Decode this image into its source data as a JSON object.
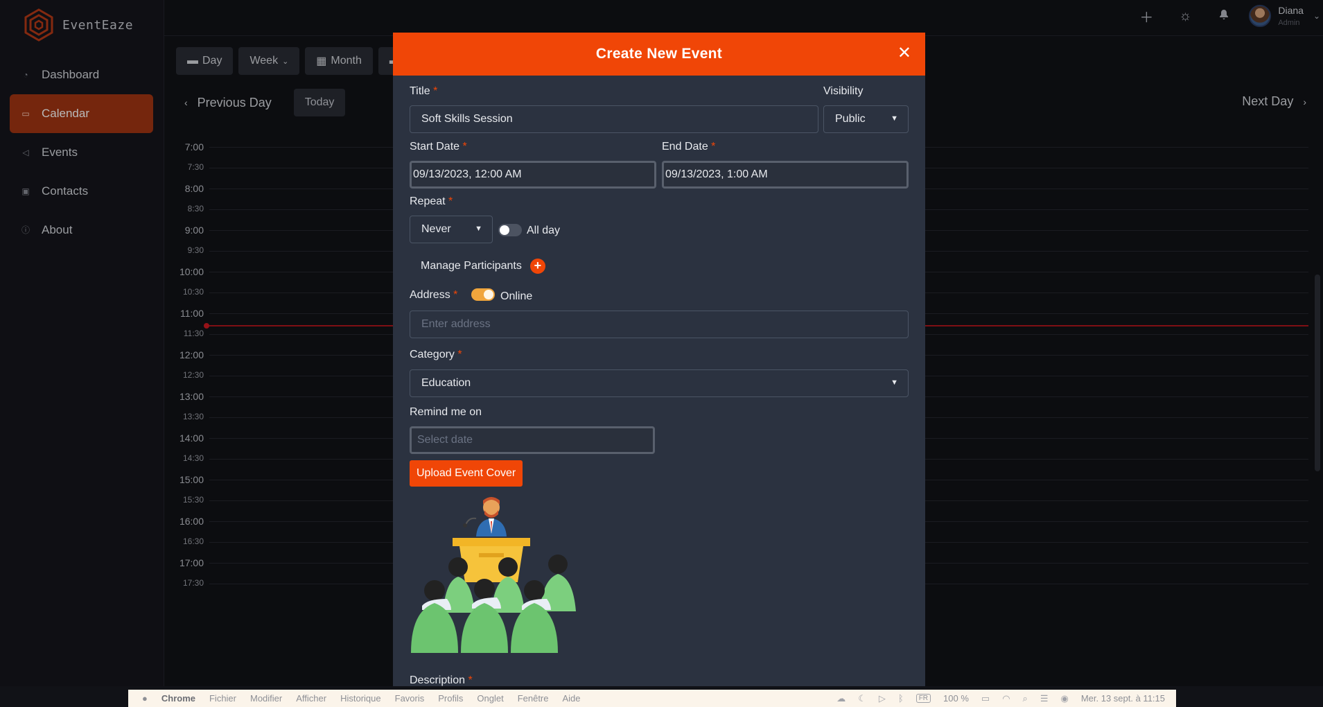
{
  "app": {
    "name": "EventEaze"
  },
  "sidebar": {
    "items": [
      {
        "label": "Dashboard",
        "icon": "gauge-icon",
        "active": false
      },
      {
        "label": "Calendar",
        "icon": "calendar-icon",
        "active": true
      },
      {
        "label": "Events",
        "icon": "megaphone-icon",
        "active": false
      },
      {
        "label": "Contacts",
        "icon": "id-card-icon",
        "active": false
      },
      {
        "label": "About",
        "icon": "info-icon",
        "active": false
      }
    ]
  },
  "topbar": {
    "user_name": "Diana",
    "user_role": "Admin"
  },
  "calendar": {
    "views": [
      "Day",
      "Week",
      "Month"
    ],
    "prev_label": "Previous Day",
    "today_label": "Today",
    "next_label": "Next Day",
    "times": [
      "7:00",
      "7:30",
      "8:00",
      "8:30",
      "9:00",
      "9:30",
      "10:00",
      "10:30",
      "11:00",
      "11:30",
      "12:00",
      "12:30",
      "13:00",
      "13:30",
      "14:00",
      "14:30",
      "15:00",
      "15:30",
      "16:00",
      "16:30",
      "17:00",
      "17:30"
    ]
  },
  "modal": {
    "title": "Create New Event",
    "title_label": "Title",
    "title_value": "Soft Skills Session",
    "visibility_label": "Visibility",
    "visibility_value": "Public",
    "start_label": "Start Date",
    "start_value": "09/13/2023, 12:00 AM",
    "end_label": "End Date",
    "end_value": "09/13/2023, 1:00 AM",
    "repeat_label": "Repeat",
    "repeat_value": "Never",
    "allday_label": "All day",
    "manage_label": "Manage Participants",
    "address_label": "Address",
    "online_label": "Online",
    "address_placeholder": "Enter address",
    "category_label": "Category",
    "category_value": "Education",
    "remind_label": "Remind me on",
    "remind_placeholder": "Select date",
    "upload_label": "Upload Event Cover",
    "description_label": "Description",
    "required_mark": "*"
  },
  "menubar": {
    "app": "Chrome",
    "items": [
      "Fichier",
      "Modifier",
      "Afficher",
      "Historique",
      "Favoris",
      "Profils",
      "Onglet",
      "Fenêtre",
      "Aide"
    ],
    "keyboard": "FR",
    "battery": "100 %",
    "datetime": "Mer. 13 sept. à 11:15"
  },
  "colors": {
    "accent": "#f04607",
    "modal_bg": "#2b3240",
    "page_bg": "#111217",
    "now_line": "#b0161c"
  }
}
